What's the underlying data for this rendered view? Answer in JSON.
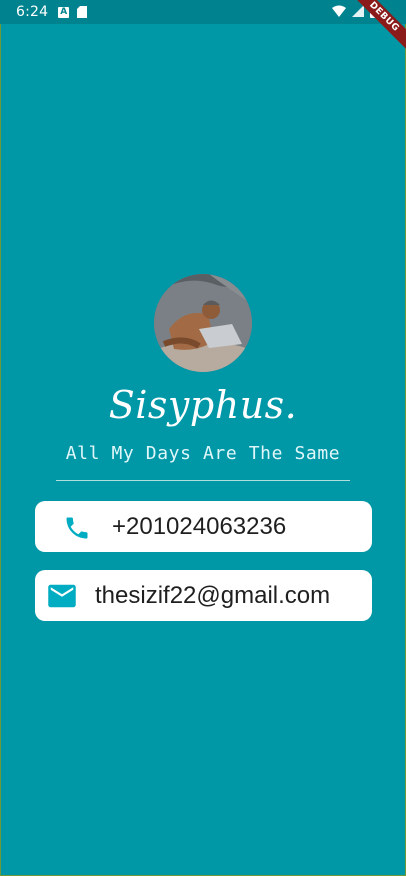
{
  "status_bar": {
    "time": "6:24",
    "icon_a_label": "A"
  },
  "debug_banner": "DEBUG",
  "profile": {
    "avatar_alt": "profile-photo",
    "name": "Sisyphus.",
    "tagline": "All My Days Are The Same"
  },
  "contacts": {
    "phone": {
      "icon": "phone-icon",
      "value": "+201024063236"
    },
    "email": {
      "icon": "mail-icon",
      "value": "thesizif22@gmail.com"
    }
  },
  "colors": {
    "background": "#0097a7",
    "status_bar": "#00838f",
    "icon": "#00acc1"
  }
}
